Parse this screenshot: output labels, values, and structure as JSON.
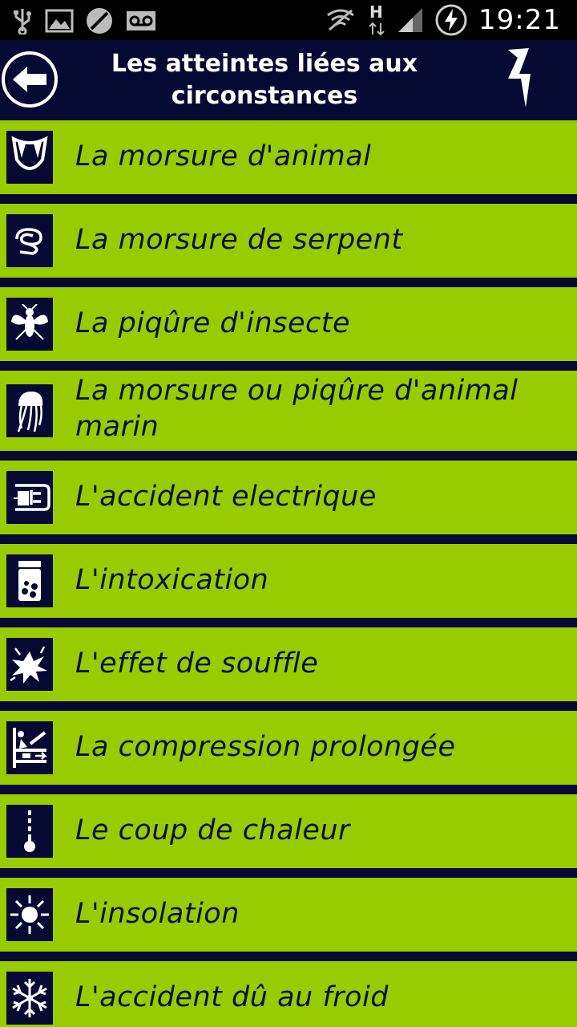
{
  "status_bar": {
    "time": "19:21",
    "network_label": "H",
    "left_icons": [
      "usb-icon",
      "gallery-icon",
      "blocked-icon",
      "voicemail-icon"
    ],
    "right_icons": [
      "wifi-off-icon",
      "network-h-icon",
      "signal-icon",
      "battery-charging-icon"
    ]
  },
  "header": {
    "title_line1": "Les atteintes liées aux",
    "title_line2": "circonstances",
    "back_icon": "arrow-left-icon",
    "logo_icon": "lightning-icon"
  },
  "colors": {
    "navy": "#060a33",
    "green": "#99cc00",
    "text": "#0b0f3a"
  },
  "items": [
    {
      "label": "La morsure d'animal",
      "icon": "fangs-icon"
    },
    {
      "label": "La morsure de serpent",
      "icon": "snake-icon"
    },
    {
      "label": "La piqûre d'insecte",
      "icon": "wasp-icon"
    },
    {
      "label": "La morsure ou piqûre d'animal marin",
      "icon": "jellyfish-icon"
    },
    {
      "label": "L'accident electrique",
      "icon": "plug-icon"
    },
    {
      "label": "L'intoxication",
      "icon": "pill-bottle-icon"
    },
    {
      "label": "L'effet de souffle",
      "icon": "explosion-icon"
    },
    {
      "label": "La compression prolongée",
      "icon": "crush-icon"
    },
    {
      "label": "Le coup de chaleur",
      "icon": "thermometer-icon"
    },
    {
      "label": "L'insolation",
      "icon": "sun-icon"
    },
    {
      "label": "L'accident dû au froid",
      "icon": "snowflake-icon"
    }
  ]
}
